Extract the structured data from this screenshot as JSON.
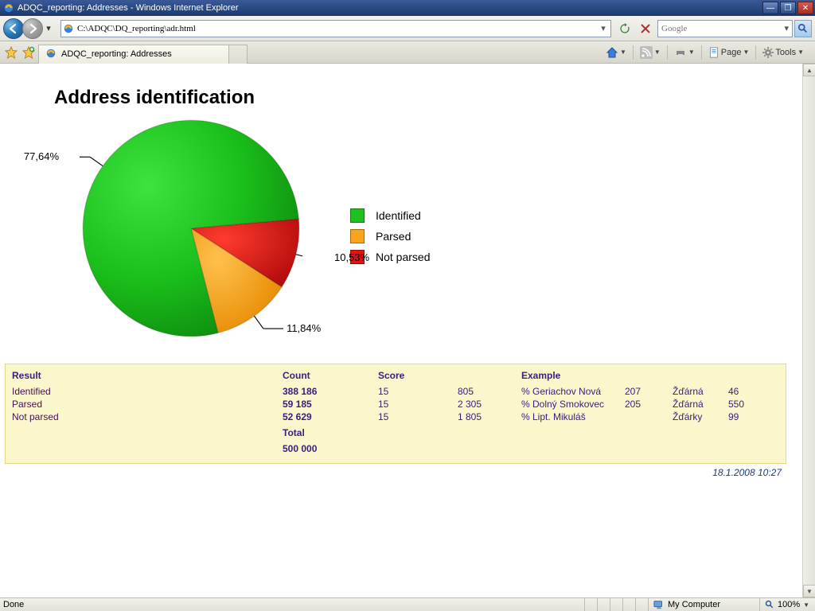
{
  "window": {
    "title": "ADQC_reporting: Addresses - Windows Internet Explorer",
    "address": "C:\\ADQC\\DQ_reporting\\adr.html",
    "search_placeholder": "Google",
    "tab_title": "ADQC_reporting: Addresses",
    "commands": {
      "page": "Page",
      "tools": "Tools"
    },
    "status_left": "Done",
    "status_zone": "My Computer",
    "status_zoom": "100%"
  },
  "page": {
    "title": "Address identification",
    "timestamp": "18.1.2008 10:27"
  },
  "legend": {
    "identified": "Identified",
    "parsed": "Parsed",
    "notparsed": "Not parsed"
  },
  "labels": {
    "identified": "77,64%",
    "parsed": "11,84%",
    "notparsed": "10,53%"
  },
  "table": {
    "headers": {
      "result": "Result",
      "count": "Count",
      "score": "Score",
      "example": "Example"
    },
    "rows": [
      {
        "result": "Identified",
        "count": "388 186",
        "sc1": "15",
        "sc2": "805",
        "ex1": "% Geriachov Nová",
        "ex1n": "207",
        "ex2": "Žďárná",
        "ex2n": "46"
      },
      {
        "result": "Parsed",
        "count": "59 185",
        "sc1": "15",
        "sc2": "2 305",
        "ex1": "% Dolný Smokovec",
        "ex1n": "205",
        "ex2": "Žďárná",
        "ex2n": "550"
      },
      {
        "result": "Not parsed",
        "count": "52 629",
        "sc1": "15",
        "sc2": "1 805",
        "ex1": "% Lipt. Mikuláš",
        "ex1n": "",
        "ex2": "Žďárky",
        "ex2n": "99"
      }
    ],
    "total_label": "Total",
    "total_value": "500 000"
  },
  "chart_data": {
    "type": "pie",
    "title": "Address identification",
    "categories": [
      "Identified",
      "Parsed",
      "Not parsed"
    ],
    "values": [
      77.64,
      11.84,
      10.53
    ],
    "colors": [
      "#1fbf1f",
      "#f7a51f",
      "#e01414"
    ]
  }
}
